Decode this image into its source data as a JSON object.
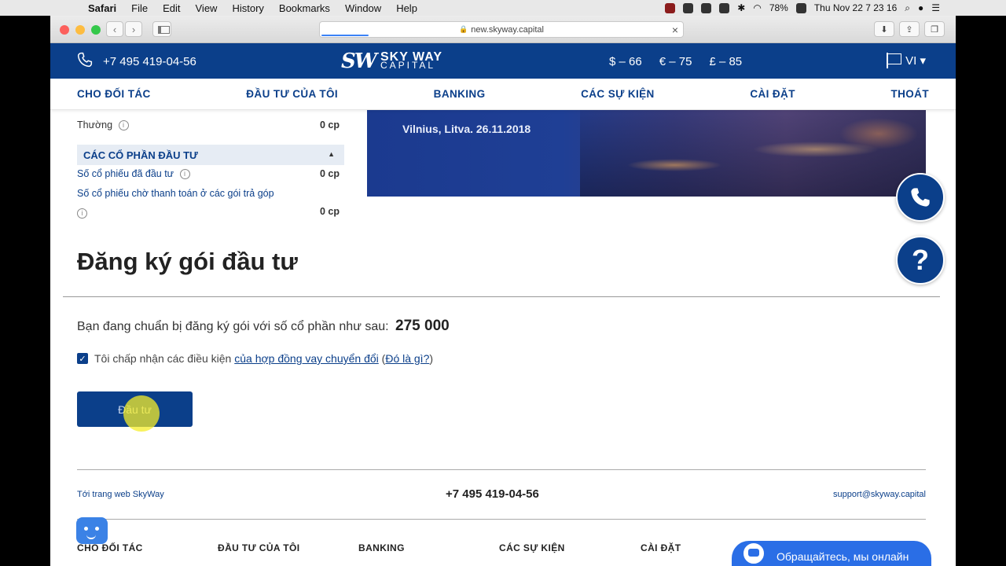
{
  "macos": {
    "apple": "",
    "menus": [
      "Safari",
      "File",
      "Edit",
      "View",
      "History",
      "Bookmarks",
      "Window",
      "Help"
    ],
    "battery": "78%",
    "datetime": "Thu Nov 22  7 23 16"
  },
  "browser": {
    "url": "new.skyway.capital"
  },
  "header": {
    "phone": "+7 495 419-04-56",
    "logo_mark": "SW",
    "logo_line1": "SKY WAY",
    "logo_line2": "CAPITAL",
    "rates": [
      "$ – 66",
      "€ – 75",
      "£ – 85"
    ],
    "language": "VI ▾"
  },
  "nav": {
    "items": [
      "CHO ĐỐI TÁC",
      "ĐẦU TƯ CỦA TÔI",
      "BANKING",
      "CÁC SỰ KIỆN",
      "CÀI ĐẶT",
      "THOÁT"
    ]
  },
  "sidebar": {
    "regular_label": "Thường",
    "regular_value": "0 cp",
    "section_title": "CÁC CỔ PHẦN ĐẦU TƯ",
    "invested_label": "Số cổ phiếu đã đầu tư",
    "invested_value": "0 cp",
    "pending_label": "Số cổ phiếu chờ thanh toán ở các gói trả góp",
    "pending_value": "0 cp"
  },
  "banner": {
    "text": "Vilnius, Litva. 26.11.2018"
  },
  "main": {
    "title": "Đăng ký gói đầu tư",
    "summary_text": "Bạn đang chuẩn bị đăng ký gói với số cổ phần như sau:",
    "summary_amount": "275 000",
    "accept_prefix": "Tôi chấp nhận các điều kiện",
    "accept_link": "của hợp đồng vay chuyển đổi",
    "accept_paren_open": "(",
    "accept_help_link": "Đó là gì?",
    "accept_paren_close": ")",
    "invest_button": "Đầu tư"
  },
  "footer": {
    "site_link": "Tới trang web SkyWay",
    "phone": "+7 495 419-04-56",
    "email": "support@skyway.capital",
    "nav": [
      "CHO ĐỐI TÁC",
      "ĐẦU TƯ CỦA TÔI",
      "BANKING",
      "CÁC SỰ KIỆN",
      "CÀI ĐẶT"
    ]
  },
  "chat": {
    "label": "Обращайтесь, мы онлайн"
  },
  "colors": {
    "brand_blue": "#0b3f8a",
    "chat_blue": "#2a6ee6"
  }
}
